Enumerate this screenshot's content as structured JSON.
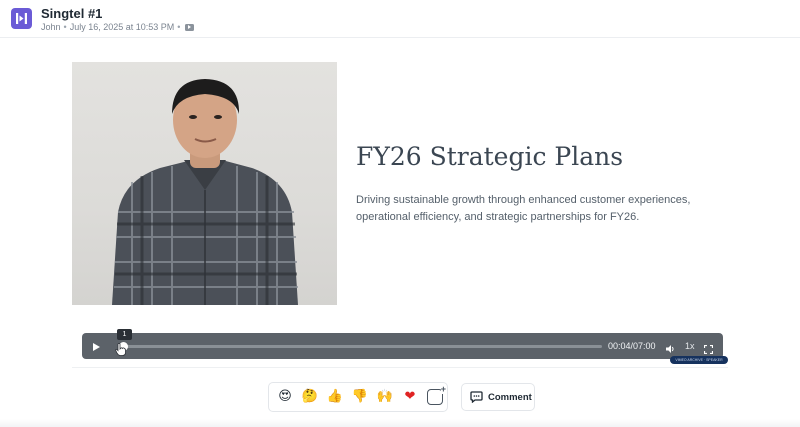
{
  "header": {
    "title": "Singtel #1",
    "author": "John",
    "separator": "•",
    "timestamp": "July 16, 2025 at 10:53 PM",
    "logo_icon": "app-logo-icon",
    "badge_icon": "video-icon",
    "brand_color": "#6b5bd6"
  },
  "slide": {
    "title": "FY26 Strategic Plans",
    "description": "Driving sustainable growth through enhanced customer experiences, operational efficiency, and strategic partnerships for FY26.",
    "presenter_image": "presenter-photo"
  },
  "player": {
    "tooltip_time": "1",
    "time_display": "00:04/07:00",
    "speed": "1x",
    "progress_fraction": 0.0095,
    "play_icon": "play-icon",
    "volume_icon": "volume-icon",
    "fullscreen_icon": "fullscreen-icon",
    "watermark": "VIMEO ARCHIVE · SPEAKER"
  },
  "reactions": {
    "items": [
      {
        "icon": "heart-eyes-emoji",
        "glyph": "😍"
      },
      {
        "icon": "thinking-emoji",
        "glyph": "🤔"
      },
      {
        "icon": "thumbs-up-emoji",
        "glyph": "👍"
      },
      {
        "icon": "thumbs-down-emoji",
        "glyph": "👎"
      },
      {
        "icon": "raised-hands-emoji",
        "glyph": "🙌"
      },
      {
        "icon": "red-heart-emoji",
        "glyph": "❤"
      }
    ],
    "add_icon": "add-reaction-icon"
  },
  "comment": {
    "label": "Comment",
    "icon": "comment-icon"
  }
}
